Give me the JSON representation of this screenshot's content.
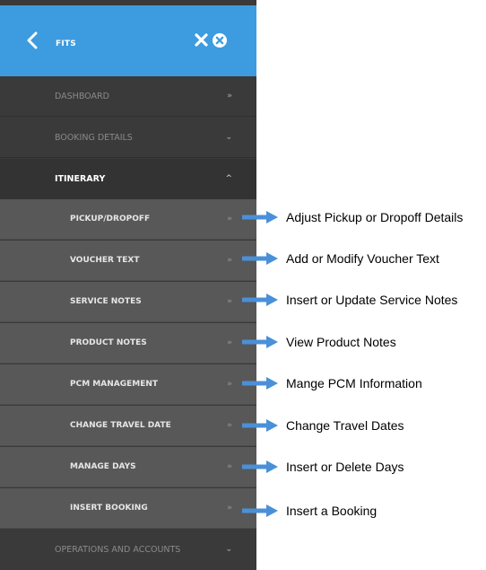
{
  "header": {
    "title": "FITS",
    "bg_color": "#3d9be0"
  },
  "menu": {
    "dashboard": {
      "label": "DASHBOARD",
      "chevron": "»"
    },
    "booking_details": {
      "label": "BOOKING DETAILS",
      "chevron": "⌄"
    },
    "itinerary": {
      "label": "ITINERARY",
      "chevron": "^"
    },
    "operations": {
      "label": "OPERATIONS AND ACCOUNTS",
      "chevron": "⌄"
    }
  },
  "submenu": [
    {
      "label": "PICKUP/DROPOFF",
      "chevron": "»"
    },
    {
      "label": "VOUCHER TEXT",
      "chevron": "»"
    },
    {
      "label": "SERVICE NOTES",
      "chevron": "»"
    },
    {
      "label": "PRODUCT NOTES",
      "chevron": "»"
    },
    {
      "label": "PCM MANAGEMENT",
      "chevron": "»"
    },
    {
      "label": "CHANGE TRAVEL DATE",
      "chevron": "»"
    },
    {
      "label": "MANAGE DAYS",
      "chevron": "»"
    },
    {
      "label": "INSERT BOOKING",
      "chevron": "»"
    }
  ],
  "annotations": [
    "Adjust Pickup or Dropoff Details",
    "Add or Modify Voucher Text",
    "Insert or Update Service Notes",
    "View Product Notes",
    "Mange PCM Information",
    "Change Travel Dates",
    "Insert or Delete Days",
    "Insert a Booking"
  ],
  "colors": {
    "arrow": "#4a90d9",
    "panel": "#3a3a3a",
    "submenu": "#585858"
  }
}
